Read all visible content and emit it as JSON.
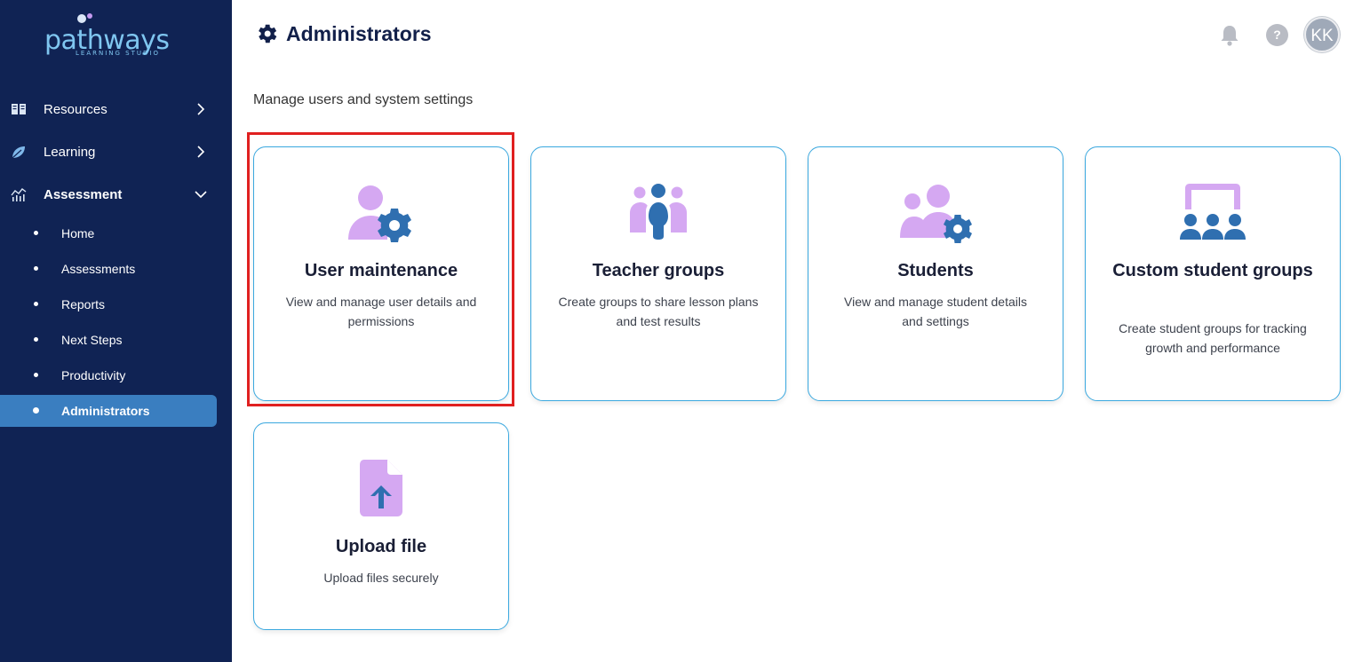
{
  "logo": {
    "name": "pathways",
    "tagline": "LEARNING STUDIO"
  },
  "sidebar": {
    "items": [
      {
        "label": "Resources",
        "icon": "book-icon",
        "expanded": false
      },
      {
        "label": "Learning",
        "icon": "leaf-icon",
        "expanded": false
      },
      {
        "label": "Assessment",
        "icon": "chart-icon",
        "expanded": true
      }
    ],
    "subitems": [
      {
        "label": "Home"
      },
      {
        "label": "Assessments"
      },
      {
        "label": "Reports"
      },
      {
        "label": "Next Steps"
      },
      {
        "label": "Productivity"
      },
      {
        "label": "Administrators",
        "active": true
      }
    ]
  },
  "header": {
    "title": "Administrators",
    "help": "?",
    "avatar_initials": "KK"
  },
  "main": {
    "subtitle": "Manage users and system settings",
    "cards": [
      {
        "title": "User maintenance",
        "desc": "View and manage user details and permissions",
        "icon": "user-gear-icon"
      },
      {
        "title": "Teacher groups",
        "desc": "Create groups to share lesson plans and test results",
        "icon": "teacher-group-icon"
      },
      {
        "title": "Students",
        "desc": "View and manage student details and settings",
        "icon": "students-gear-icon"
      },
      {
        "title": "Custom student groups",
        "desc": "Create student groups for tracking growth and performance",
        "icon": "classroom-icon"
      },
      {
        "title": "Upload file",
        "desc": "Upload files securely",
        "icon": "file-upload-icon"
      }
    ]
  },
  "colors": {
    "sidebar_bg": "#102354",
    "active_item": "#3a7ec0",
    "card_border": "#3aa8df",
    "icon_purple": "#d5a8f2",
    "icon_blue": "#2f6fb0",
    "highlight": "#e02020"
  }
}
